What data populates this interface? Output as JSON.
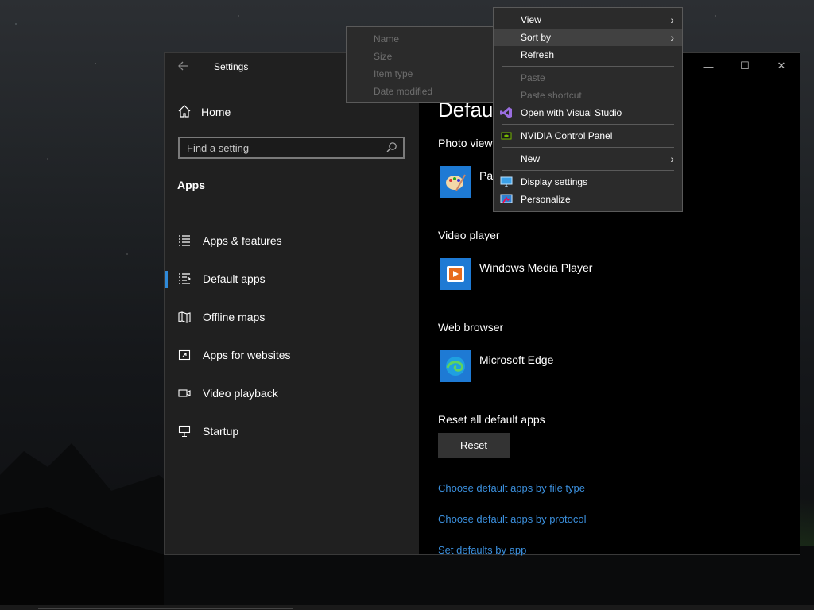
{
  "window": {
    "title": "Settings",
    "controls": {
      "minimize": "—",
      "maximize": "☐",
      "close": "✕"
    }
  },
  "sidebar": {
    "home_label": "Home",
    "search_placeholder": "Find a setting",
    "section_title": "Apps",
    "items": [
      {
        "label": "Apps & features",
        "icon": "list-icon",
        "active": false
      },
      {
        "label": "Default apps",
        "icon": "default-apps-icon",
        "active": true
      },
      {
        "label": "Offline maps",
        "icon": "map-icon",
        "active": false
      },
      {
        "label": "Apps for websites",
        "icon": "website-icon",
        "active": false
      },
      {
        "label": "Video playback",
        "icon": "video-icon",
        "active": false
      },
      {
        "label": "Startup",
        "icon": "startup-icon",
        "active": false
      }
    ]
  },
  "main": {
    "title_partial": "Defau",
    "photo_viewer_label": "Photo view",
    "photo_app": "Pai",
    "video_label": "Video player",
    "video_app": "Windows Media Player",
    "browser_label": "Web browser",
    "browser_app": "Microsoft Edge",
    "reset_label": "Reset all default apps",
    "reset_button": "Reset",
    "links": [
      "Choose default apps by file type",
      "Choose default apps by protocol",
      "Set defaults by app"
    ]
  },
  "context_menu": {
    "view": "View",
    "sort_by": "Sort by",
    "refresh": "Refresh",
    "paste": "Paste",
    "paste_shortcut": "Paste shortcut",
    "open_vs": "Open with Visual Studio",
    "nvidia": "NVIDIA Control Panel",
    "new": "New",
    "display_settings": "Display settings",
    "personalize": "Personalize"
  },
  "sort_submenu": {
    "items": [
      "Name",
      "Size",
      "Item type",
      "Date modified"
    ]
  },
  "colors": {
    "accent": "#2f8ad9",
    "link": "#3b8fdc",
    "sidebar_bg": "#202020",
    "menu_bg": "#2b2b2b"
  }
}
